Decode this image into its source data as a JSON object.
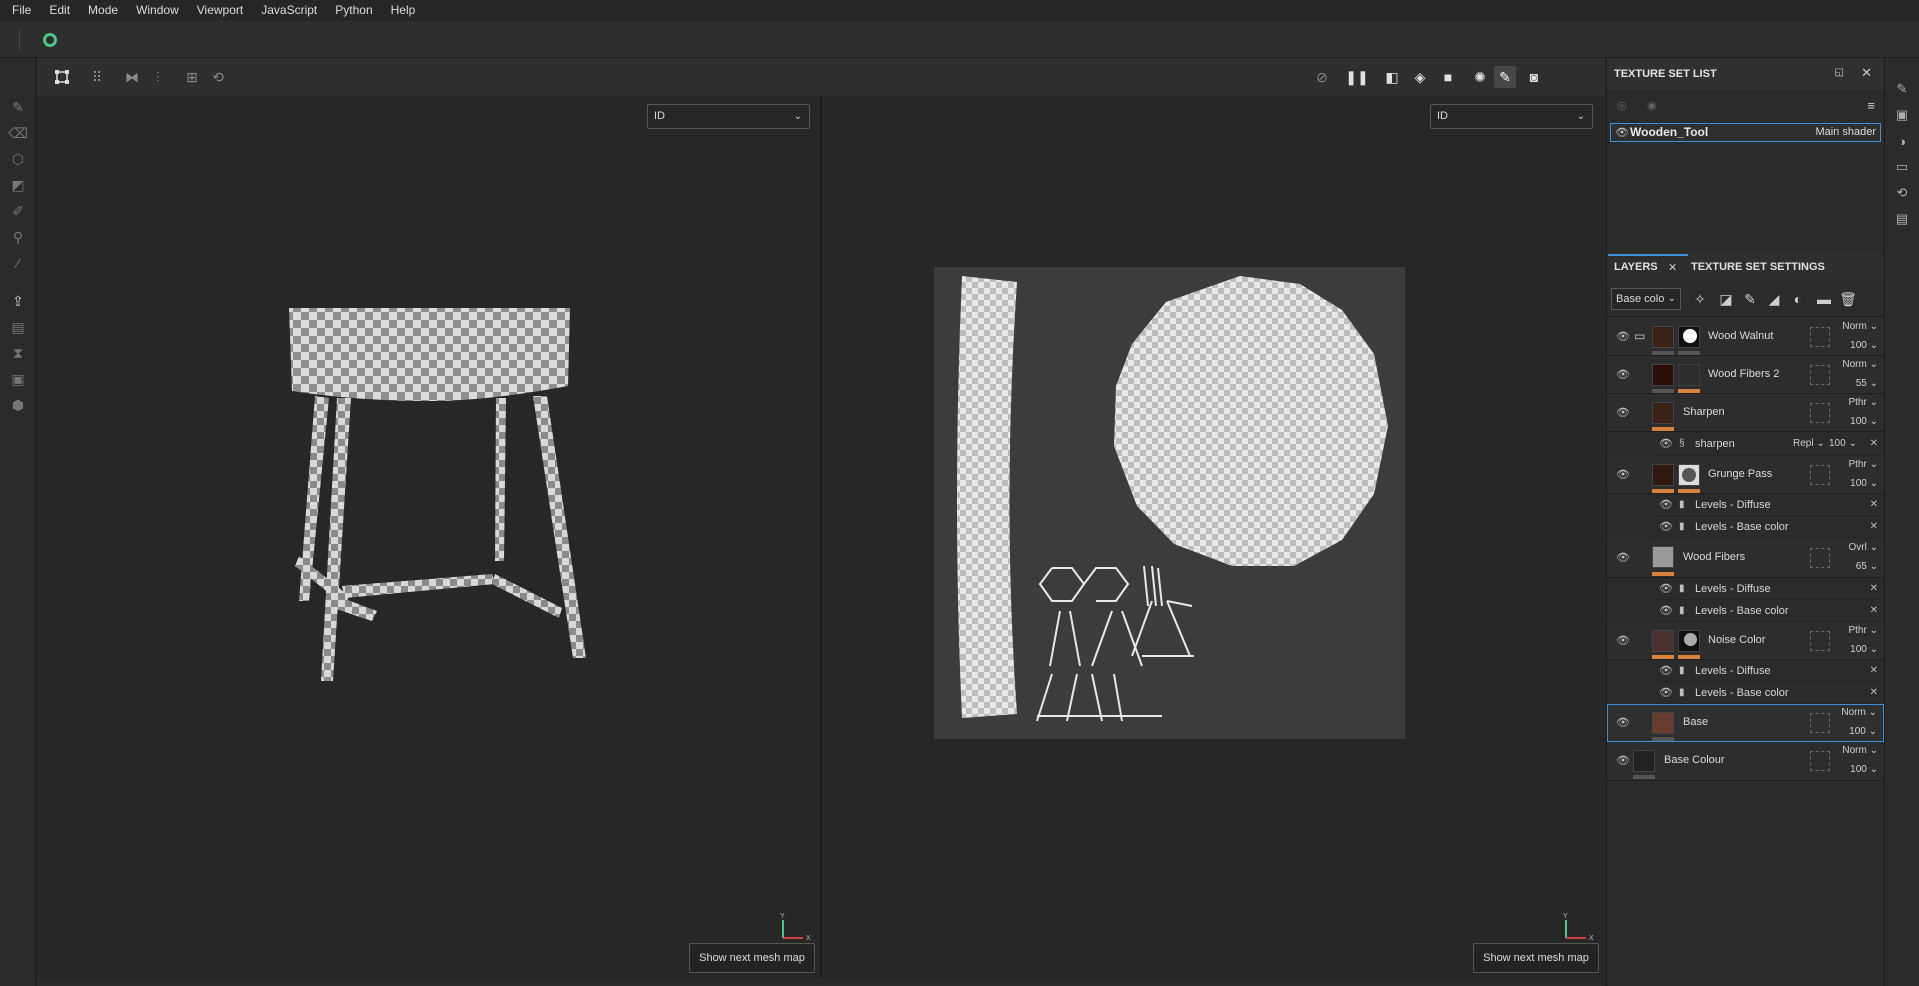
{
  "menu": [
    "File",
    "Edit",
    "Mode",
    "Window",
    "Viewport",
    "JavaScript",
    "Python",
    "Help"
  ],
  "viewport": {
    "left_dropdown": "ID",
    "right_dropdown": "ID",
    "next_map_button": "Show next mesh map",
    "axis_y": "Y",
    "axis_x": "X"
  },
  "texture_set_list": {
    "title": "TEXTURE SET LIST",
    "item_name": "Wooden_Tool",
    "item_shader": "Main shader"
  },
  "layers_panel": {
    "tab_layers": "LAYERS",
    "tab_settings": "TEXTURE SET SETTINGS",
    "channel_select": "Base colo",
    "layers": [
      {
        "name": "Wood Walnut",
        "blend": "Norm",
        "opacity": "100"
      },
      {
        "name": "Wood Fibers 2",
        "blend": "Norm",
        "opacity": "55"
      },
      {
        "name": "Sharpen",
        "blend": "Pthr",
        "opacity": "100"
      },
      {
        "name": "Grunge Pass",
        "blend": "Pthr",
        "opacity": "100"
      },
      {
        "name": "Wood Fibers",
        "blend": "Ovrl",
        "opacity": "65"
      },
      {
        "name": "Noise Color",
        "blend": "Pthr",
        "opacity": "100"
      },
      {
        "name": "Base",
        "blend": "Norm",
        "opacity": "100"
      },
      {
        "name": "Base Colour",
        "blend": "Norm",
        "opacity": "100"
      }
    ],
    "sharpen_filter": {
      "name": "sharpen",
      "blend": "Repl",
      "opacity": "100"
    },
    "effects": {
      "levels_diffuse": "Levels - Diffuse",
      "levels_base": "Levels - Base color"
    }
  },
  "colors": {
    "accent": "#3f8fd8",
    "orange": "#d9823b",
    "logo": "#4fc58a"
  }
}
